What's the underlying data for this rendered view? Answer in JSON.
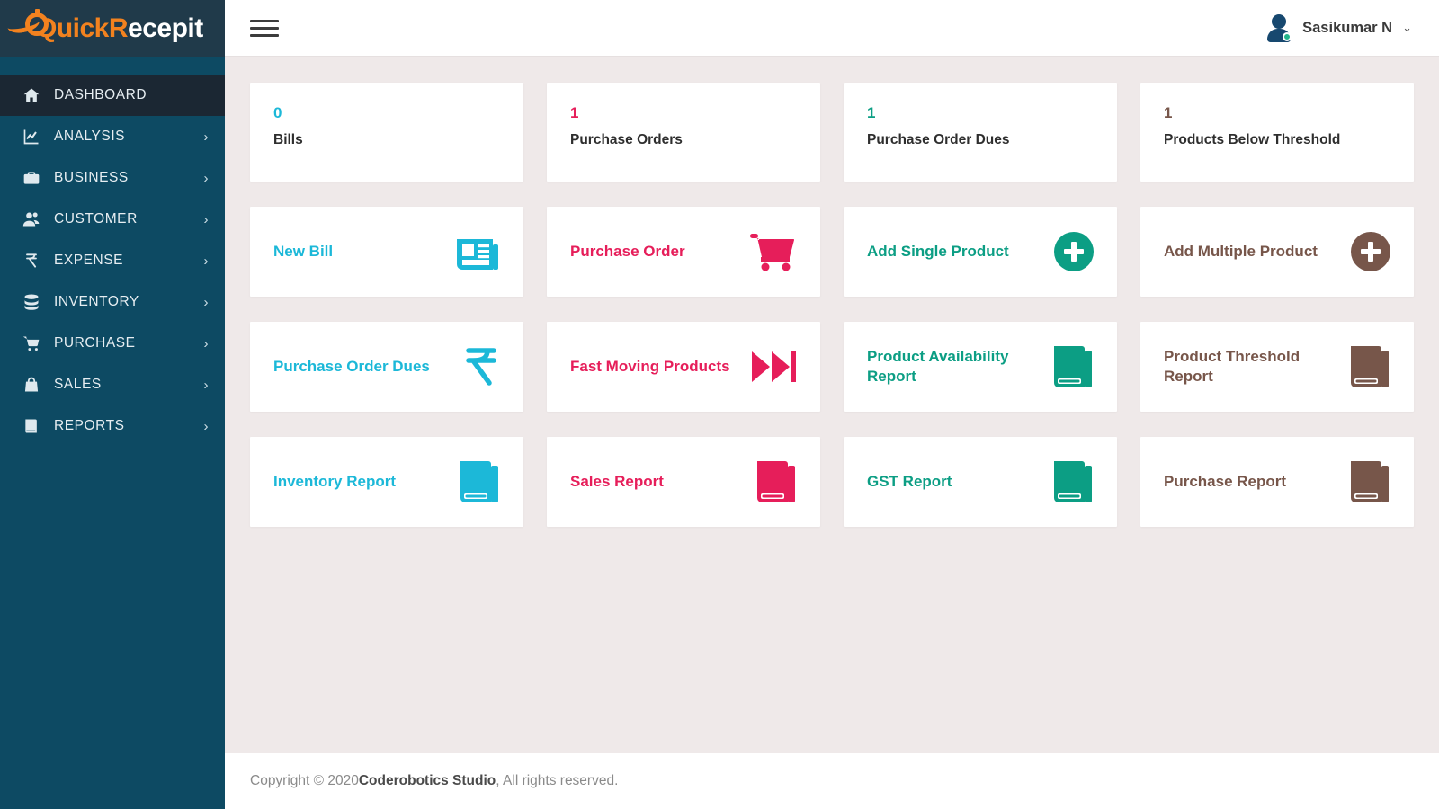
{
  "brand": {
    "name_part1": "Quick",
    "name_part2_r": "R",
    "name_part2_rest": "ecepit",
    "orange": "#f2821f"
  },
  "sidebar": {
    "items": [
      {
        "label": "DASHBOARD",
        "icon": "home-icon",
        "active": true,
        "chevron": ""
      },
      {
        "label": "ANALYSIS",
        "icon": "chart-icon",
        "active": false,
        "chevron": "›"
      },
      {
        "label": "BUSINESS",
        "icon": "briefcase-icon",
        "active": false,
        "chevron": "›"
      },
      {
        "label": "CUSTOMER",
        "icon": "users-icon",
        "active": false,
        "chevron": "›"
      },
      {
        "label": "EXPENSE",
        "icon": "rupee-icon",
        "active": false,
        "chevron": "›"
      },
      {
        "label": "INVENTORY",
        "icon": "database-icon",
        "active": false,
        "chevron": "›"
      },
      {
        "label": "PURCHASE",
        "icon": "cart-icon",
        "active": false,
        "chevron": "›"
      },
      {
        "label": "SALES",
        "icon": "bag-icon",
        "active": false,
        "chevron": "›"
      },
      {
        "label": "REPORTS",
        "icon": "book-icon",
        "active": false,
        "chevron": "›"
      }
    ]
  },
  "topbar": {
    "menu_icon": "hamburger-icon",
    "user_name": "Sasikumar N",
    "user_chevron": "⌄",
    "avatar_icon": "user-avatar-icon",
    "status_color": "#23b58a"
  },
  "stats": [
    {
      "value": "0",
      "label": "Bills",
      "color": "#1cb8d8"
    },
    {
      "value": "1",
      "label": "Purchase Orders",
      "color": "#e61e5a"
    },
    {
      "value": "1",
      "label": "Purchase Order Dues",
      "color": "#0c9e84"
    },
    {
      "value": "1",
      "label": "Products Below Threshold",
      "color": "#77564a"
    }
  ],
  "actions": [
    {
      "label": "New Bill",
      "color": "#1cb8d8",
      "icon": "newspaper-icon"
    },
    {
      "label": "Purchase Order",
      "color": "#e61e5a",
      "icon": "shopping-cart-icon"
    },
    {
      "label": "Add Single Product",
      "color": "#0c9e84",
      "icon": "plus-circle-icon"
    },
    {
      "label": "Add Multiple Product",
      "color": "#77564a",
      "icon": "plus-circle-icon"
    },
    {
      "label": "Purchase Order Dues",
      "color": "#1cb8d8",
      "icon": "rupee-icon"
    },
    {
      "label": "Fast Moving Products",
      "color": "#e61e5a",
      "icon": "fast-forward-icon"
    },
    {
      "label": "Product Availability Report",
      "color": "#0c9e84",
      "icon": "book-icon"
    },
    {
      "label": "Product Threshold Report",
      "color": "#77564a",
      "icon": "book-icon"
    },
    {
      "label": "Inventory Report",
      "color": "#1cb8d8",
      "icon": "book-icon"
    },
    {
      "label": "Sales Report",
      "color": "#e61e5a",
      "icon": "book-icon"
    },
    {
      "label": "GST Report",
      "color": "#0c9e84",
      "icon": "book-icon"
    },
    {
      "label": "Purchase Report",
      "color": "#77564a",
      "icon": "book-icon"
    }
  ],
  "footer": {
    "prefix": "Copyright © 2020 ",
    "company": "Coderobotics Studio",
    "suffix": " , All rights reserved."
  }
}
